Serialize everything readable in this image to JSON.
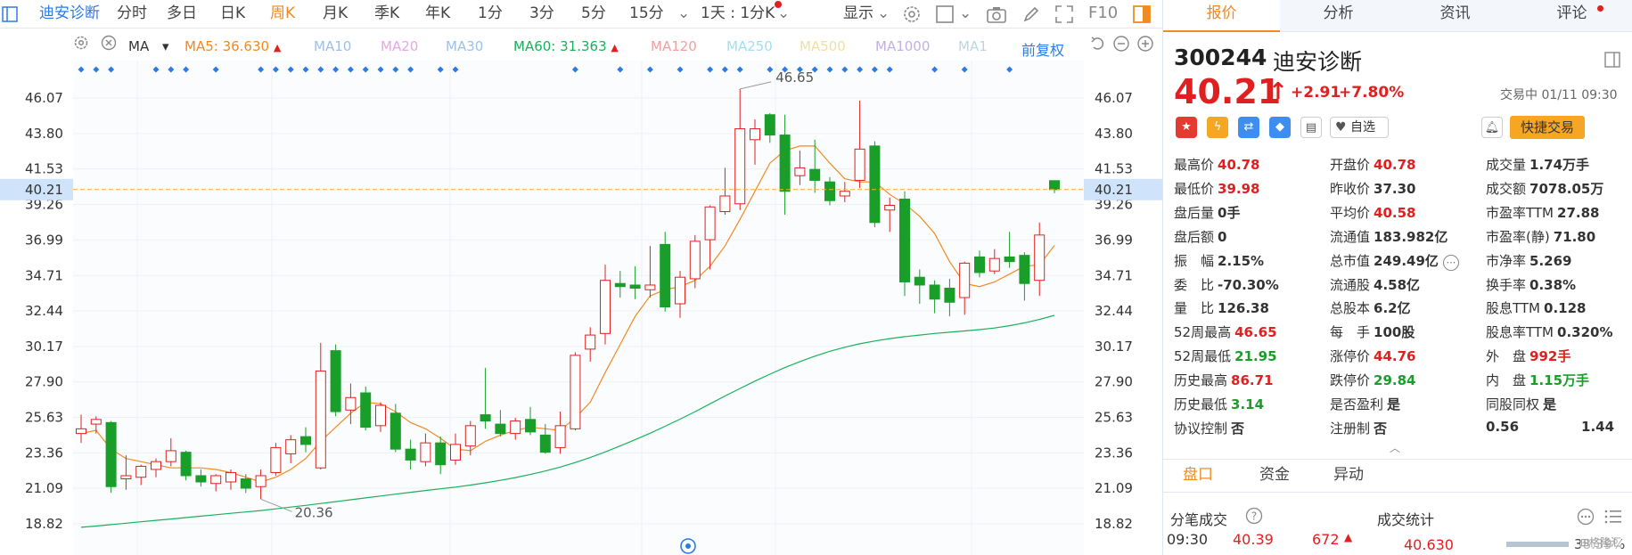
{
  "toolbar": {
    "stock_name": "迪安诊断",
    "periods": [
      "分时",
      "多日",
      "日K",
      "周K",
      "月K",
      "季K",
      "年K",
      "1分",
      "3分",
      "5分",
      "15分"
    ],
    "active_period": "周K",
    "timeframe": "1天 : 1分K",
    "display_label": "显示",
    "f10_label": "F10"
  },
  "ma_legend": {
    "label": "MA",
    "items": [
      {
        "name": "MA5",
        "value": "36.630",
        "color": "#f08a24",
        "arrow": "▲"
      },
      {
        "name": "MA10",
        "value": "",
        "color": "#9ec0e6"
      },
      {
        "name": "MA20",
        "value": "",
        "color": "#e6a6e6"
      },
      {
        "name": "MA30",
        "value": "",
        "color": "#9ec0e6"
      },
      {
        "name": "MA60",
        "value": "31.363",
        "color": "#1ab05a",
        "arrow": "▲"
      },
      {
        "name": "MA120",
        "value": "",
        "color": "#f0a0a0"
      },
      {
        "name": "MA250",
        "value": "",
        "color": "#9ee0f0"
      },
      {
        "name": "MA500",
        "value": "",
        "color": "#f0e0a0"
      },
      {
        "name": "MA1000",
        "value": "",
        "color": "#c0b0e6"
      },
      {
        "name": "MA1",
        "value": "",
        "color": "#bcd4ea"
      }
    ],
    "adjust_label": "前复权"
  },
  "chart_data": {
    "type": "candlestick",
    "y_ticks": [
      "46.07",
      "43.80",
      "41.53",
      "39.26",
      "36.99",
      "34.71",
      "32.44",
      "30.17",
      "27.90",
      "25.63",
      "23.36",
      "21.09",
      "18.82"
    ],
    "ylim": [
      18.82,
      46.07
    ],
    "current_price_label": "40.21",
    "current_price": 40.21,
    "high_annotation": "46.65",
    "low_annotation": "20.36",
    "candles": [
      {
        "o": 24.6,
        "h": 25.8,
        "l": 24.0,
        "c": 24.9
      },
      {
        "o": 25.2,
        "h": 25.7,
        "l": 24.6,
        "c": 25.5
      },
      {
        "o": 25.3,
        "h": 25.4,
        "l": 20.8,
        "c": 21.2
      },
      {
        "o": 21.7,
        "h": 23.2,
        "l": 21.0,
        "c": 21.9
      },
      {
        "o": 21.8,
        "h": 22.6,
        "l": 21.3,
        "c": 22.5
      },
      {
        "o": 22.3,
        "h": 23.0,
        "l": 21.8,
        "c": 22.8
      },
      {
        "o": 22.8,
        "h": 24.3,
        "l": 22.5,
        "c": 23.5
      },
      {
        "o": 23.4,
        "h": 23.5,
        "l": 21.6,
        "c": 21.9
      },
      {
        "o": 21.9,
        "h": 22.3,
        "l": 21.2,
        "c": 21.5
      },
      {
        "o": 21.4,
        "h": 22.0,
        "l": 20.9,
        "c": 21.9
      },
      {
        "o": 21.5,
        "h": 22.3,
        "l": 21.0,
        "c": 22.1
      },
      {
        "o": 21.7,
        "h": 22.0,
        "l": 20.8,
        "c": 21.1
      },
      {
        "o": 21.2,
        "h": 22.3,
        "l": 20.4,
        "c": 21.9
      },
      {
        "o": 22.1,
        "h": 24.0,
        "l": 21.9,
        "c": 23.7
      },
      {
        "o": 23.3,
        "h": 24.5,
        "l": 22.7,
        "c": 24.2
      },
      {
        "o": 24.4,
        "h": 25.0,
        "l": 23.4,
        "c": 23.9
      },
      {
        "o": 22.4,
        "h": 30.4,
        "l": 22.3,
        "c": 28.6
      },
      {
        "o": 29.9,
        "h": 30.3,
        "l": 25.7,
        "c": 26.0
      },
      {
        "o": 26.1,
        "h": 27.8,
        "l": 25.2,
        "c": 26.9
      },
      {
        "o": 27.2,
        "h": 27.6,
        "l": 24.8,
        "c": 25.0
      },
      {
        "o": 25.1,
        "h": 26.6,
        "l": 24.7,
        "c": 26.4
      },
      {
        "o": 25.9,
        "h": 26.5,
        "l": 23.4,
        "c": 23.6
      },
      {
        "o": 23.6,
        "h": 24.2,
        "l": 22.3,
        "c": 22.9
      },
      {
        "o": 22.8,
        "h": 24.6,
        "l": 22.5,
        "c": 24.0
      },
      {
        "o": 24.0,
        "h": 24.4,
        "l": 22.0,
        "c": 22.6
      },
      {
        "o": 22.9,
        "h": 24.6,
        "l": 22.6,
        "c": 23.9
      },
      {
        "o": 23.8,
        "h": 25.4,
        "l": 23.2,
        "c": 25.1
      },
      {
        "o": 25.8,
        "h": 28.8,
        "l": 24.9,
        "c": 25.4
      },
      {
        "o": 25.2,
        "h": 26.1,
        "l": 24.4,
        "c": 24.6
      },
      {
        "o": 24.6,
        "h": 25.6,
        "l": 24.2,
        "c": 25.4
      },
      {
        "o": 25.5,
        "h": 26.3,
        "l": 24.5,
        "c": 24.7
      },
      {
        "o": 24.5,
        "h": 25.2,
        "l": 23.3,
        "c": 23.4
      },
      {
        "o": 23.7,
        "h": 26.0,
        "l": 23.3,
        "c": 25.1
      },
      {
        "o": 24.9,
        "h": 29.8,
        "l": 24.8,
        "c": 29.6
      },
      {
        "o": 30.0,
        "h": 31.4,
        "l": 29.2,
        "c": 30.9
      },
      {
        "o": 31.0,
        "h": 35.4,
        "l": 30.3,
        "c": 34.4
      },
      {
        "o": 34.2,
        "h": 35.0,
        "l": 33.3,
        "c": 34.0
      },
      {
        "o": 34.1,
        "h": 35.3,
        "l": 33.2,
        "c": 33.9
      },
      {
        "o": 33.8,
        "h": 36.6,
        "l": 33.3,
        "c": 34.1
      },
      {
        "o": 36.7,
        "h": 37.5,
        "l": 32.4,
        "c": 32.7
      },
      {
        "o": 32.9,
        "h": 35.0,
        "l": 32.0,
        "c": 34.6
      },
      {
        "o": 34.5,
        "h": 37.3,
        "l": 33.9,
        "c": 36.9
      },
      {
        "o": 37.0,
        "h": 39.2,
        "l": 35.1,
        "c": 39.1
      },
      {
        "o": 38.8,
        "h": 41.6,
        "l": 38.6,
        "c": 39.8
      },
      {
        "o": 39.3,
        "h": 46.65,
        "l": 38.9,
        "c": 44.1
      },
      {
        "o": 43.4,
        "h": 44.7,
        "l": 41.8,
        "c": 44.1
      },
      {
        "o": 45.0,
        "h": 45.1,
        "l": 43.2,
        "c": 43.7
      },
      {
        "o": 43.7,
        "h": 45.0,
        "l": 38.6,
        "c": 40.1
      },
      {
        "o": 41.1,
        "h": 42.7,
        "l": 40.5,
        "c": 41.6
      },
      {
        "o": 41.5,
        "h": 43.4,
        "l": 40.0,
        "c": 40.8
      },
      {
        "o": 40.7,
        "h": 41.0,
        "l": 39.2,
        "c": 39.5
      },
      {
        "o": 39.8,
        "h": 40.7,
        "l": 39.4,
        "c": 40.1
      },
      {
        "o": 40.8,
        "h": 45.9,
        "l": 40.3,
        "c": 42.8
      },
      {
        "o": 43.0,
        "h": 43.3,
        "l": 37.8,
        "c": 38.1
      },
      {
        "o": 38.9,
        "h": 39.7,
        "l": 37.5,
        "c": 39.2
      },
      {
        "o": 39.6,
        "h": 40.1,
        "l": 33.4,
        "c": 34.3
      },
      {
        "o": 34.6,
        "h": 35.1,
        "l": 32.9,
        "c": 34.1
      },
      {
        "o": 34.1,
        "h": 34.4,
        "l": 32.3,
        "c": 33.2
      },
      {
        "o": 33.9,
        "h": 34.5,
        "l": 32.1,
        "c": 33.0
      },
      {
        "o": 33.3,
        "h": 35.6,
        "l": 32.2,
        "c": 35.5
      },
      {
        "o": 35.9,
        "h": 36.3,
        "l": 34.6,
        "c": 34.9
      },
      {
        "o": 35.0,
        "h": 36.4,
        "l": 34.8,
        "c": 35.8
      },
      {
        "o": 35.9,
        "h": 37.5,
        "l": 35.2,
        "c": 35.6
      },
      {
        "o": 36.0,
        "h": 36.2,
        "l": 33.1,
        "c": 34.2
      },
      {
        "o": 34.4,
        "h": 38.1,
        "l": 33.4,
        "c": 37.3
      },
      {
        "o": 40.78,
        "h": 40.78,
        "l": 39.98,
        "c": 40.21
      }
    ],
    "ma5": [
      24.6,
      24.8,
      23.6,
      23.0,
      22.8,
      22.6,
      22.4,
      22.4,
      22.4,
      22.3,
      22.1,
      21.8,
      21.5,
      21.8,
      22.3,
      23.0,
      24.1,
      25.0,
      25.9,
      26.6,
      26.5,
      26.0,
      25.3,
      24.9,
      24.3,
      23.6,
      23.5,
      24.1,
      24.5,
      24.8,
      25.0,
      24.9,
      24.8,
      25.6,
      26.6,
      28.5,
      30.3,
      32.1,
      33.4,
      33.8,
      34.0,
      34.4,
      35.3,
      36.6,
      38.3,
      40.1,
      41.9,
      42.7,
      43.0,
      43.0,
      41.9,
      40.9,
      40.7,
      40.7,
      39.9,
      39.3,
      38.5,
      37.4,
      35.6,
      34.2,
      34.0,
      34.3,
      34.8,
      35.3,
      35.4,
      36.63
    ],
    "ma60": [
      18.6,
      18.68,
      18.77,
      18.86,
      18.95,
      19.04,
      19.13,
      19.22,
      19.31,
      19.4,
      19.49,
      19.58,
      19.67,
      19.78,
      19.89,
      20.0,
      20.12,
      20.24,
      20.36,
      20.48,
      20.6,
      20.72,
      20.84,
      20.95,
      21.06,
      21.17,
      21.3,
      21.44,
      21.6,
      21.78,
      21.98,
      22.2,
      22.45,
      22.74,
      23.06,
      23.42,
      23.8,
      24.2,
      24.62,
      25.06,
      25.52,
      26.0,
      26.5,
      27.0,
      27.48,
      27.95,
      28.4,
      28.82,
      29.2,
      29.55,
      29.86,
      30.12,
      30.34,
      30.52,
      30.67,
      30.8,
      30.9,
      31.0,
      31.08,
      31.16,
      31.25,
      31.35,
      31.5,
      31.68,
      31.9,
      32.16
    ],
    "top_markers": [
      0,
      1,
      2,
      5,
      6,
      7,
      9,
      12,
      13,
      14,
      15,
      16,
      17,
      18,
      19,
      20,
      21,
      22,
      24,
      25,
      33,
      36,
      38,
      40,
      42,
      43,
      44,
      46,
      47,
      48,
      49,
      50,
      51,
      52,
      53,
      54,
      57,
      59,
      62
    ]
  },
  "right_panel": {
    "tabs": [
      "报价",
      "分析",
      "资讯",
      "评论"
    ],
    "active_tab": "报价",
    "code": "300244",
    "name": "迪安诊断",
    "price": "40.21",
    "arrow": "↑",
    "change": "+2.91",
    "change_pct": "+7.80%",
    "status": "交易中 01/11 09:30",
    "watch_label": "自选",
    "trade_button": "快捷交易",
    "quote_rows": [
      [
        {
          "label": "最高价",
          "value": "40.78",
          "color": "red"
        },
        {
          "label": "开盘价",
          "value": "40.78",
          "color": "red"
        },
        {
          "label": "成交量",
          "value": "1.74万手",
          "color": "dark"
        }
      ],
      [
        {
          "label": "最低价",
          "value": "39.98",
          "color": "red"
        },
        {
          "label": "昨收价",
          "value": "37.30",
          "color": "dark"
        },
        {
          "label": "成交额",
          "value": "7078.05万",
          "color": "dark"
        }
      ],
      [
        {
          "label": "盘后量",
          "value": "0手",
          "color": "dark"
        },
        {
          "label": "平均价",
          "value": "40.58",
          "color": "red"
        },
        {
          "label": "市盈率TTM",
          "value": "27.88",
          "color": "dark"
        }
      ],
      [
        {
          "label": "盘后额",
          "value": "0",
          "color": "dark"
        },
        {
          "label": "流通值",
          "value": "183.982亿",
          "color": "dark"
        },
        {
          "label": "市盈率(静)",
          "value": "71.80",
          "color": "dark"
        }
      ],
      [
        {
          "label": "振　幅",
          "value": "2.15%",
          "color": "dark"
        },
        {
          "label": "总市值",
          "value": "249.49亿",
          "color": "dark"
        },
        {
          "label": "市净率",
          "value": "5.269",
          "color": "dark"
        }
      ],
      [
        {
          "label": "委　比",
          "value": "-70.30%",
          "color": "dark"
        },
        {
          "label": "流通股",
          "value": "4.58亿",
          "color": "dark"
        },
        {
          "label": "换手率",
          "value": "0.38%",
          "color": "dark"
        }
      ],
      [
        {
          "label": "量　比",
          "value": "126.38",
          "color": "dark"
        },
        {
          "label": "总股本",
          "value": "6.2亿",
          "color": "dark"
        },
        {
          "label": "股息TTM",
          "value": "0.128",
          "color": "dark"
        }
      ],
      [
        {
          "label": "52周最高",
          "value": "46.65",
          "color": "red"
        },
        {
          "label": "每　手",
          "value": "100股",
          "color": "dark"
        },
        {
          "label": "股息率TTM",
          "value": "0.320%",
          "color": "dark"
        }
      ],
      [
        {
          "label": "52周最低",
          "value": "21.95",
          "color": "green"
        },
        {
          "label": "涨停价",
          "value": "44.76",
          "color": "red"
        },
        {
          "label": "外　盘",
          "value": "992手",
          "color": "red"
        }
      ],
      [
        {
          "label": "历史最高",
          "value": "86.71",
          "color": "red"
        },
        {
          "label": "跌停价",
          "value": "29.84",
          "color": "green"
        },
        {
          "label": "内　盘",
          "value": "1.15万手",
          "color": "green"
        }
      ],
      [
        {
          "label": "历史最低",
          "value": "3.14",
          "color": "green"
        },
        {
          "label": "是否盈利",
          "value": "是",
          "color": "dark"
        },
        {
          "label": "同股同权",
          "value": "是",
          "color": "dark"
        }
      ],
      [
        {
          "label": "协议控制",
          "value": "否",
          "color": "dark"
        },
        {
          "label": "注册制",
          "value": "否",
          "color": "dark"
        },
        {
          "label": "0.56",
          "value": "1.44",
          "color": "dark"
        }
      ]
    ],
    "bottom_tabs": [
      "盘口",
      "资金",
      "异动"
    ],
    "bottom_active": "盘口",
    "trades_title": "分笔成交",
    "stats_title": "成交统计",
    "trade_time": "09:30",
    "trade_price": "40.39",
    "trade_vol": "672",
    "stats_value": "40.630",
    "stats_pct": "38.39%"
  },
  "colors": {
    "up": "#e02020",
    "down": "#1a9e2a",
    "ma5": "#f08a24",
    "ma60": "#1ab05a",
    "accent": "#f08a24",
    "marker": "#2c7be5",
    "price_line": "#f0b030"
  }
}
